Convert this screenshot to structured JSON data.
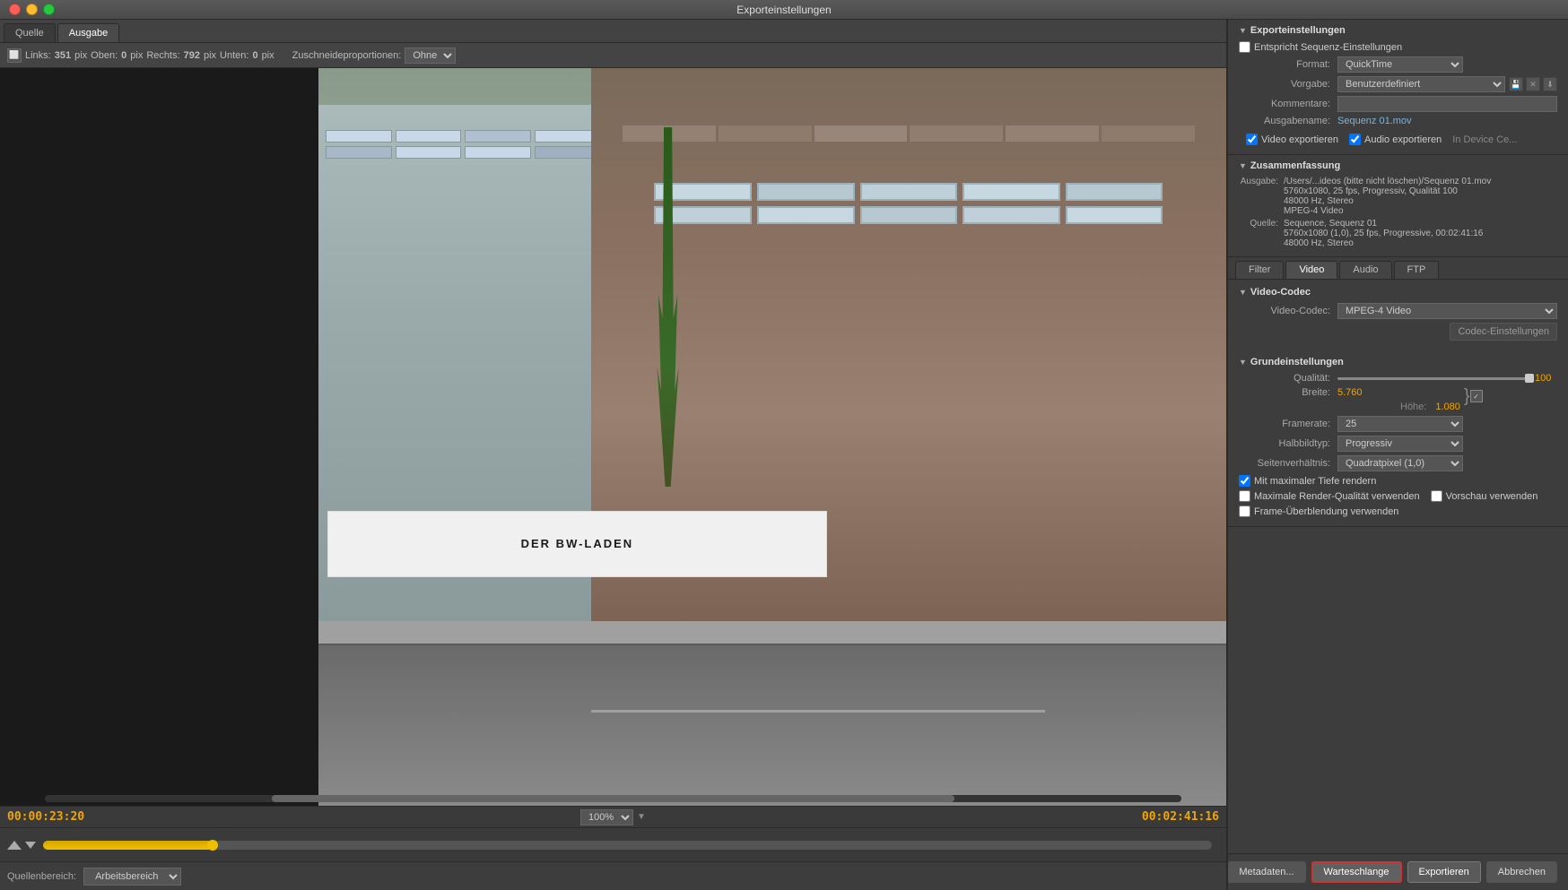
{
  "window": {
    "title": "Exporteinstellungen",
    "buttons": {
      "close": "close",
      "minimize": "minimize",
      "maximize": "maximize"
    }
  },
  "tabs": {
    "quelle": "Quelle",
    "ausgabe": "Ausgabe"
  },
  "toolbar": {
    "crop_icon": "⬜",
    "links_label": "Links:",
    "links_value": "351",
    "pix1": "pix",
    "oben_label": "Oben:",
    "oben_value": "0",
    "pix2": "pix",
    "rechts_label": "Rechts:",
    "rechts_value": "792",
    "pix3": "pix",
    "unten_label": "Unten:",
    "unten_value": "0",
    "pix4": "pix",
    "proportionen_label": "Zuschneideproportionen:",
    "proportionen_value": "Ohne"
  },
  "preview": {
    "sign_text": "DER BW-LADEN"
  },
  "timecode": {
    "current": "00:00:23:20",
    "total": "00:02:41:16",
    "zoom": "100%"
  },
  "timeline": {
    "source_label": "Quellenbereich:",
    "source_value": "Arbeitsbereich"
  },
  "export_settings": {
    "header": "Exporteinstellungen",
    "entspricht_label": "Entspricht Sequenz-Einstellungen",
    "format_label": "Format:",
    "format_value": "QuickTime",
    "vorgabe_label": "Vorgabe:",
    "vorgabe_value": "Benutzerdefiniert",
    "kommentare_label": "Kommentare:",
    "kommentare_value": "",
    "ausgabename_label": "Ausgabename:",
    "ausgabename_value": "Sequenz 01.mov",
    "video_export_label": "Video exportieren",
    "audio_export_label": "Audio exportieren",
    "in_device_label": "In Device Ce...",
    "zusammenfassung_header": "Zusammenfassung",
    "ausgabe_key": "Ausgabe:",
    "ausgabe_val": "/Users/...ideos (bitte nicht löschen)/Sequenz 01.mov\n5760x1080, 25 fps, Progressiv, Qualität 100\n48000 Hz, Stereo\nMPEG-4 Video",
    "quelle_key": "Quelle:",
    "quelle_val": "Sequence, Sequenz 01\n5760x1080 (1,0), 25 fps, Progressive, 00:02:41:16\n48000 Hz, Stereo"
  },
  "sub_tabs": {
    "filter": "Filter",
    "video": "Video",
    "audio": "Audio",
    "ftp": "FTP"
  },
  "video_codec": {
    "header": "Video-Codec",
    "codec_label": "Video-Codec:",
    "codec_value": "MPEG-4 Video",
    "codec_btn": "Codec-Einstellungen"
  },
  "grundeinstellungen": {
    "header": "Grundeinstellungen",
    "qualitaet_label": "Qualität:",
    "qualitaet_value": "100",
    "breite_label": "Breite:",
    "breite_value": "5.760",
    "hoehe_label": "Höhe:",
    "hoehe_value": "1.080",
    "framerate_label": "Framerate:",
    "framerate_value": "25",
    "halbbildtyp_label": "Halbbildtyp:",
    "halbbildtyp_value": "Progressiv",
    "seitenverhaeltnis_label": "Seitenverhältnis:",
    "seitenverhaeltnis_value": "Quadratpixel (1,0)",
    "max_tiefe_label": "Mit maximaler Tiefe rendern",
    "max_render_label": "Maximale Render-Qualität verwenden",
    "vorschau_label": "Vorschau verwenden",
    "frame_label": "Frame-Überblendung verwenden"
  },
  "bottom_buttons": {
    "metadaten": "Metadaten...",
    "warteschlange": "Warteschlange",
    "exportieren": "Exportieren",
    "abbrechen": "Abbrechen"
  }
}
